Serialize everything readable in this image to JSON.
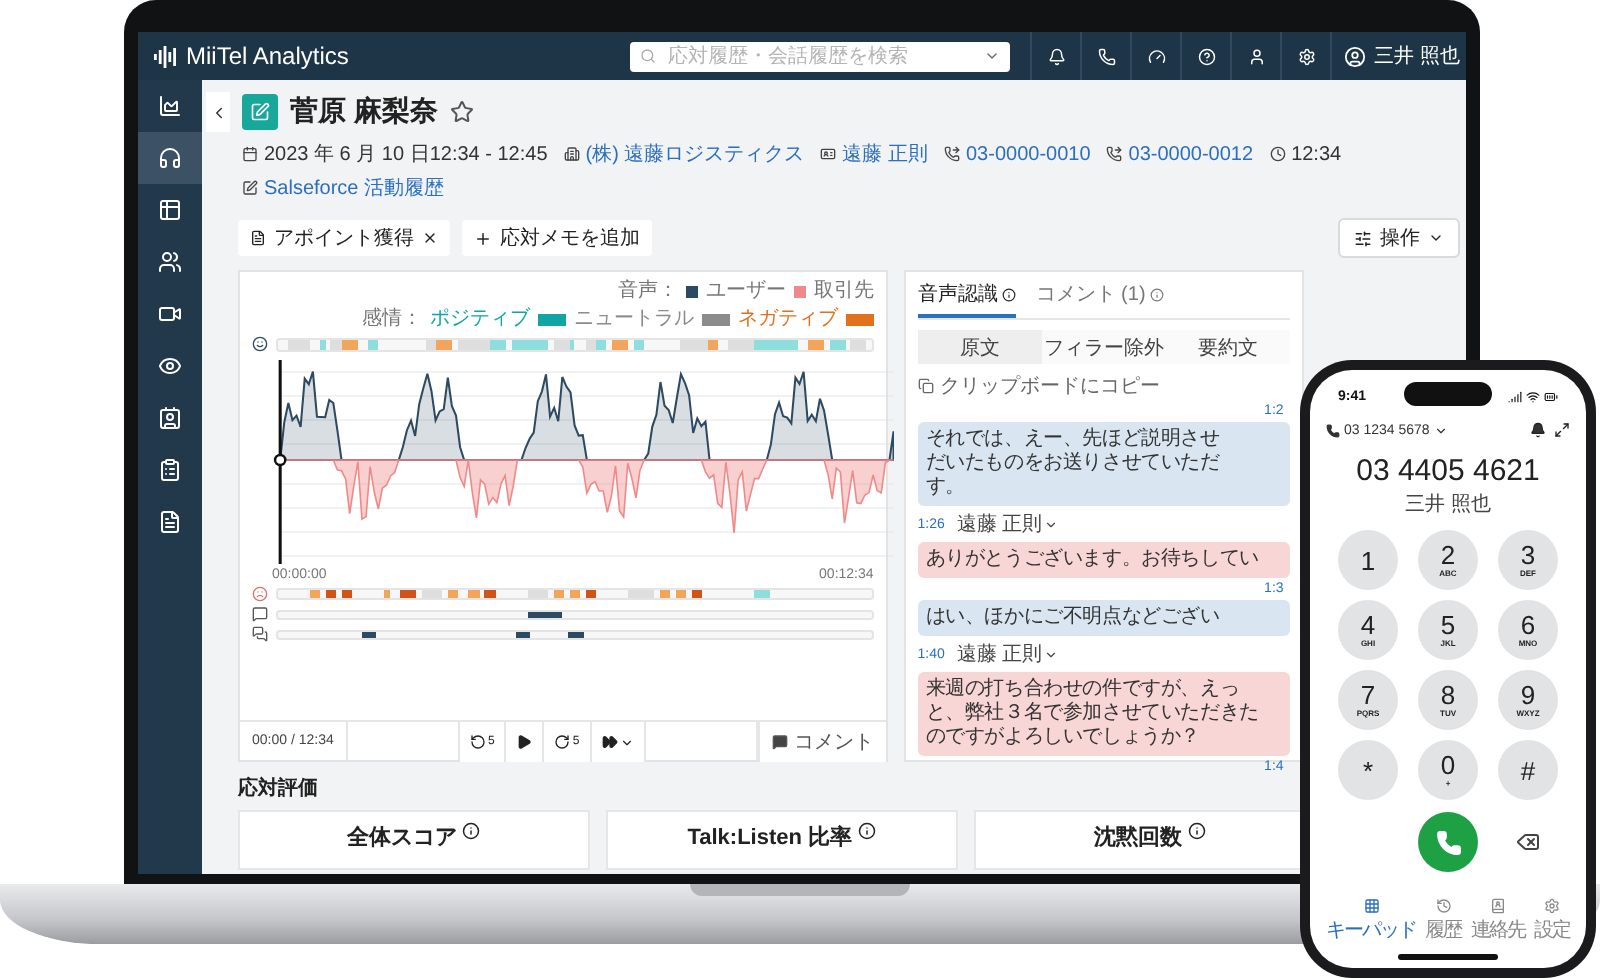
{
  "app": {
    "logo": "MiiTel Analytics",
    "search_placeholder": "応対履歴・会話履歴を検索",
    "user": "三井 照也"
  },
  "sidebar": {
    "items": [
      {
        "kind": "chart",
        "selected": false
      },
      {
        "kind": "calls",
        "selected": true
      },
      {
        "kind": "table",
        "selected": false
      },
      {
        "kind": "team",
        "selected": false
      },
      {
        "kind": "video",
        "selected": false
      },
      {
        "kind": "monitor",
        "selected": false
      },
      {
        "kind": "contacts",
        "selected": false
      },
      {
        "kind": "tasks",
        "selected": false
      },
      {
        "kind": "report",
        "selected": false
      }
    ]
  },
  "record": {
    "title": "菅原 麻梨奈",
    "starred": false,
    "meta": [
      {
        "kind": "date",
        "text": "2023 年 6 月 10 日12:34 - 12:45",
        "link": false
      },
      {
        "kind": "company",
        "text": "(株) 遠藤ロジスティクス",
        "link": true
      },
      {
        "kind": "contact",
        "text": "遠藤 正則",
        "link": true
      },
      {
        "kind": "phone",
        "text": "03-0000-0010",
        "link": true
      },
      {
        "kind": "phone",
        "text": "03-0000-0012",
        "link": true
      },
      {
        "kind": "time",
        "text": "12:34",
        "link": false
      }
    ],
    "salesforce": "Salseforce 活動履歴"
  },
  "tags": [
    "アポイント獲得"
  ],
  "add_memo": "応対メモを追加",
  "actions": "操作",
  "waveform": {
    "voice_label": "音声：",
    "speakers": [
      {
        "name": "ユーザー",
        "color": "#2c4a62"
      },
      {
        "name": "取引先",
        "color": "#f08a8a"
      }
    ],
    "emotion_label": "感情：",
    "emotions": [
      {
        "name": "ポジティブ",
        "color": "#11a5a5"
      },
      {
        "name": "ニュートラル",
        "color": "#8c8c8c"
      },
      {
        "name": "ネガティブ",
        "color": "#e2711d"
      }
    ],
    "start": "00:00:00",
    "end": "00:12:34"
  },
  "player": {
    "position": "00:00 / 12:34",
    "skip_back": "5",
    "skip_forward": "5",
    "comment": "コメント"
  },
  "evaluation": {
    "title": "応対評価",
    "cards": [
      "全体スコア",
      "Talk:Listen 比率",
      "沈黙回数"
    ]
  },
  "transcript": {
    "tabs": [
      {
        "label": "音声認識",
        "selected": true
      },
      {
        "label": "コメント (1)",
        "selected": false
      }
    ],
    "views": [
      {
        "label": "原文",
        "selected": true
      },
      {
        "label": "フィラー除外",
        "selected": false
      },
      {
        "label": "要約文",
        "selected": false
      }
    ],
    "copy": "クリップボードにコピー",
    "messages": [
      {
        "kind": "user",
        "time": "1:2",
        "lines": [
          "それでは、えー、先ほど説明させ",
          "だいたものをお送りさせていただ",
          "す。"
        ]
      },
      {
        "kind": "client",
        "time": "1:26",
        "name": "遠藤 正則",
        "lines": [
          "ありがとうございます。お待ちしてい"
        ]
      },
      {
        "kind": "user",
        "time": "1:3",
        "lines": [
          "はい、ほかにご不明点などござい"
        ]
      },
      {
        "kind": "client",
        "time": "1:40",
        "name": "遠藤 正則",
        "lines": [
          "来週の打ち合わせの件ですが、えっ",
          "と、弊社３名で参加させていただきた",
          "のですがよろしいでしょうか？"
        ]
      },
      {
        "kind": "user",
        "time": "1:4"
      }
    ]
  },
  "phone": {
    "clock": "9:41",
    "line": "03 1234 5678",
    "number": "03 4405 4621",
    "name": "三井 照也",
    "keys": [
      {
        "digit": "1"
      },
      {
        "digit": "2",
        "letters": "ABC"
      },
      {
        "digit": "3",
        "letters": "DEF"
      },
      {
        "digit": "4",
        "letters": "GHI"
      },
      {
        "digit": "5",
        "letters": "JKL"
      },
      {
        "digit": "6",
        "letters": "MNO"
      },
      {
        "digit": "7",
        "letters": "PQRS"
      },
      {
        "digit": "8",
        "letters": "TUV"
      },
      {
        "digit": "9",
        "letters": "WXYZ"
      },
      {
        "digit": "*"
      },
      {
        "digit": "0",
        "letters": "+"
      },
      {
        "digit": "#"
      }
    ],
    "tabs": [
      {
        "kind": "keypad",
        "label": "キーパッド",
        "selected": true
      },
      {
        "kind": "history",
        "label": "履歴",
        "selected": false
      },
      {
        "kind": "contacts",
        "label": "連絡先",
        "selected": false
      },
      {
        "kind": "settings",
        "label": "設定",
        "selected": false
      }
    ]
  }
}
